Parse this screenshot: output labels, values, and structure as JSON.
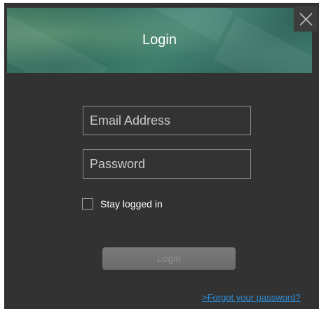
{
  "dialog": {
    "title": "Login",
    "close_icon": "close-icon",
    "email": {
      "placeholder": "Email Address",
      "value": ""
    },
    "password": {
      "placeholder": "Password",
      "value": ""
    },
    "remember": {
      "label": "Stay logged in",
      "checked": false
    },
    "login_button": "Login",
    "forgot_link": ">Forgot your password?"
  },
  "colors": {
    "background": "#323232",
    "header_accent": "#3b7c6a",
    "link": "#2f8ed8",
    "button_disabled": "#707070"
  }
}
